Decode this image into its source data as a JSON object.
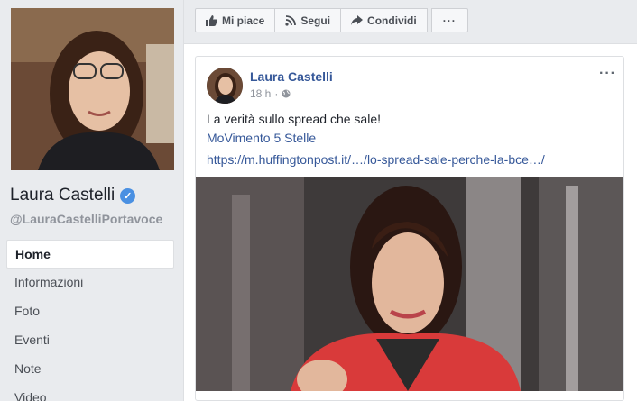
{
  "page": {
    "name": "Laura Castelli",
    "handle": "@LauraCastelliPortavoce"
  },
  "nav": {
    "items": [
      {
        "label": "Home",
        "active": true
      },
      {
        "label": "Informazioni"
      },
      {
        "label": "Foto"
      },
      {
        "label": "Eventi"
      },
      {
        "label": "Note"
      },
      {
        "label": "Video"
      }
    ]
  },
  "actions": {
    "like": "Mi piace",
    "follow": "Segui",
    "share": "Condividi",
    "more": "···"
  },
  "post": {
    "author": "Laura Castelli",
    "time": "18 h",
    "separator": "·",
    "more": "···",
    "text": "La verità sullo spread che sale!",
    "hashtag": "MoVimento 5 Stelle",
    "link": "https://m.huffingtonpost.it/…/lo-spread-sale-perche-la-bce…/"
  },
  "colors": {
    "link": "#365899",
    "background": "#e9ebee",
    "verified": "#4a90e2"
  }
}
